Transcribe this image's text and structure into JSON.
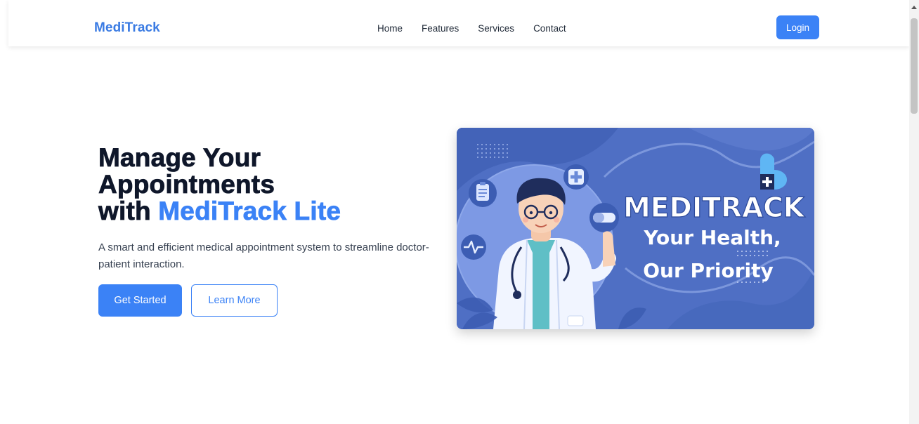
{
  "navbar": {
    "brand": "MediTrack",
    "links": [
      {
        "label": "Home"
      },
      {
        "label": "Features"
      },
      {
        "label": "Services"
      },
      {
        "label": "Contact"
      }
    ],
    "login_label": "Login"
  },
  "hero": {
    "title_line1": "Manage Your",
    "title_line2": "Appointments",
    "title_line3_prefix": "with",
    "title_accent": "MediTrack Lite",
    "description": "A smart and efficient medical appointment system to streamline doctor-patient interaction.",
    "primary_button": "Get Started",
    "secondary_button": "Learn More",
    "image": {
      "headline": "MEDITRACK",
      "tagline_line1": "Your Health,",
      "tagline_line2": "Our Priority"
    }
  },
  "colors": {
    "accent": "#3b82f6",
    "brand": "#3a7be3",
    "banner_background": "#4f6fc4",
    "heading": "#0f172a"
  }
}
